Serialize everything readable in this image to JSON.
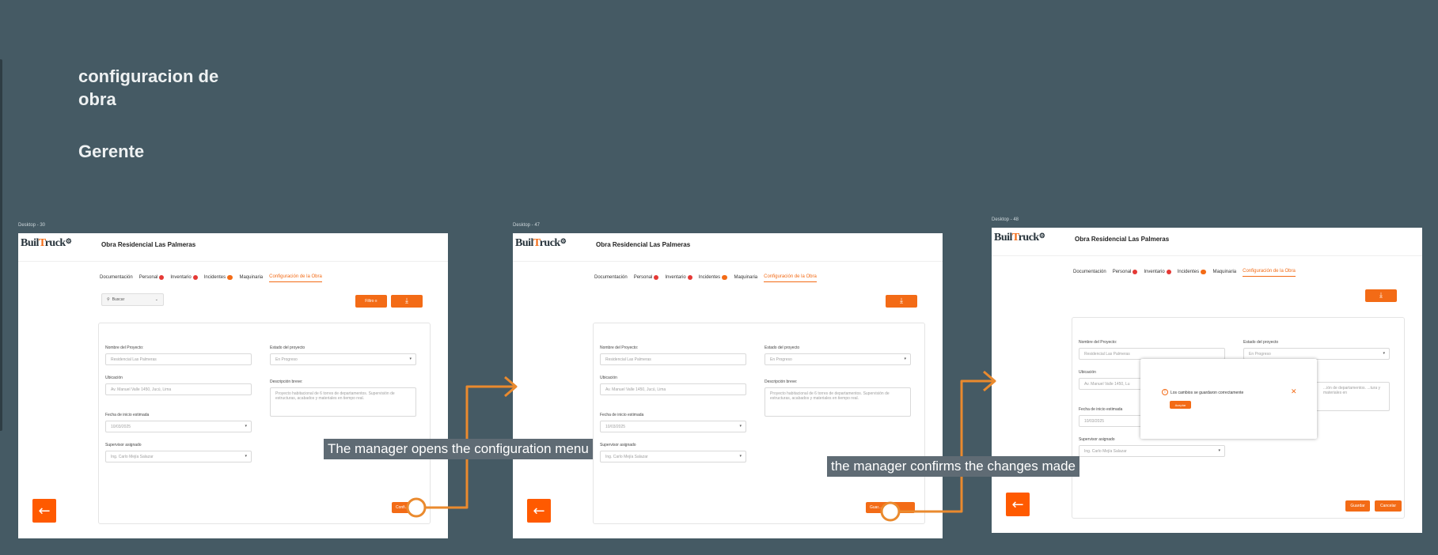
{
  "board": {
    "title": "configuracion de obra",
    "role": "Gerente"
  },
  "colors": {
    "background": "#455a64",
    "accent": "#f36b16",
    "back_button": "#ff5a00",
    "caption_bg": "#5f6b74"
  },
  "frames": [
    {
      "label": "Desktop - 30",
      "project_title": "Obra Residencial Las Palmeras",
      "tabs": [
        {
          "label": "Documentación",
          "badge": "none"
        },
        {
          "label": "Personal",
          "badge": "dot"
        },
        {
          "label": "Inventario",
          "badge": "dot"
        },
        {
          "label": "Incidentes",
          "badge": "pill"
        },
        {
          "label": "Maquinaria",
          "badge": "none"
        },
        {
          "label": "Configuración de la Obra",
          "badge": "none",
          "active": true
        }
      ],
      "search_placeholder": "Buscar",
      "filter_label": "Filtro",
      "form": {
        "name_label": "Nombre del Proyecto:",
        "name_value": "Residencial Las Palmeras",
        "status_label": "Estado del proyecto",
        "status_value": "En Progreso",
        "location_label": "Ubicación",
        "location_value": "Av. Manuel Valle 1450, Jucú, Lima",
        "description_label": "Descripción breve:",
        "description_value": "Proyecto habitacional de 6 torres de departamentos. Supervisión de estructuras, acabados y materiales en tiempo real.",
        "start_date_label": "Fecha de inicio estimada",
        "start_date_value": "10/03/2025",
        "supervisor_label": "Supervisor asignado",
        "supervisor_value": "Ing. Carlo Mejía Salazar"
      },
      "action_label": "Confi..."
    },
    {
      "label": "Desktop - 47",
      "project_title": "Obra Residencial Las Palmeras",
      "form": {
        "name_label": "Nombre del Proyecto:",
        "name_value": "Residencial Las Palmeras",
        "status_label": "Estado del proyecto",
        "status_value": "En Progreso",
        "location_label": "Ubicación",
        "location_value": "Av. Manuel Valle 1450, Jucú, Lima",
        "description_label": "Descripción breve:",
        "description_value": "Proyecto habitacional de 6 torres de departamentos. Supervisión de estructuras, acabados y materiales en tiempo real.",
        "start_date_label": "Fecha de inicio estimada",
        "start_date_value": "10/03/2025",
        "supervisor_label": "Supervisor asignado",
        "supervisor_value": "Ing. Carlo Mejía Salazar"
      },
      "action_label": "Guar..."
    },
    {
      "label": "Desktop - 48",
      "project_title": "Obra Residencial Las Palmeras",
      "form": {
        "name_label": "Nombre del Proyecto:",
        "name_value": "Residencial Las Palmeras",
        "status_label": "Estado del proyecto",
        "status_value": "En Progreso",
        "location_label": "Ubicación",
        "location_value": "Av. Manuel Valle 1450, Lu",
        "description_value": "...ión de departamentos. ...tura y materiales en",
        "start_date_label": "Fecha de inicio estimada",
        "start_date_value": "10/03/2025",
        "supervisor_label": "Supervisor asignado",
        "supervisor_value": "Ing. Carlo Mejía Salazar"
      },
      "modal": {
        "message": "Los cambios se guardaron correctamente",
        "ok_label": "Aceptar"
      },
      "save_label": "Guardar",
      "cancel_label": "Cancelar"
    }
  ],
  "captions": {
    "step1": "The manager opens the configuration menu",
    "step2": "the manager confirms the changes made"
  },
  "icons": {
    "search": "search-icon",
    "download": "download-icon",
    "back": "arrow-left-icon",
    "filter": "filter-icon",
    "info": "info-icon",
    "close": "close-icon"
  }
}
